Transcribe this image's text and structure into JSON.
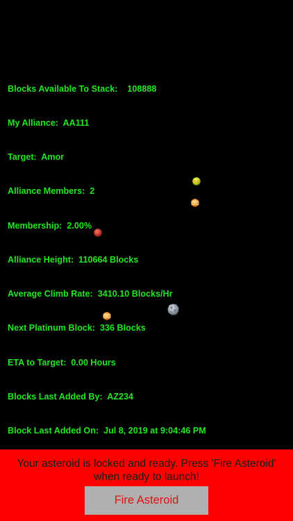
{
  "stats": {
    "blocks_available": "Blocks Available To Stack:    108888",
    "my_alliance": "My Alliance:  AA111",
    "target": "Target:  Amor",
    "alliance_members": "Alliance Members:  2",
    "membership": "Membership:  2.00%",
    "alliance_height": "Alliance Height:  110664 Blocks",
    "average_climb_rate": "Average Climb Rate:  3410.10 Blocks/Hr",
    "next_platinum_block": "Next Platinum Block:  336 Blocks",
    "eta_to_target": "ETA to Target:  0.00 Hours",
    "blocks_last_added_by": "Blocks Last Added By:  AZ234",
    "block_last_added_on": "Block Last Added On:  Jul 8, 2019 at 9:04:46 PM"
  },
  "status_message": "Your asteroid is locked and ready. Press 'Fire Asteroid'\nwhen ready to launch!",
  "fire_button_label": "Fire Asteroid",
  "icons": {
    "planet_green": "planet-icon",
    "planet_orange": "planet-icon",
    "planet_red": "planet-icon",
    "asteroid": "asteroid-icon"
  },
  "colors": {
    "background": "#000000",
    "stats_text": "#22e622",
    "bottom_bar": "#ff0000",
    "button_bg": "#b0b0b0",
    "button_text": "#e01010"
  }
}
